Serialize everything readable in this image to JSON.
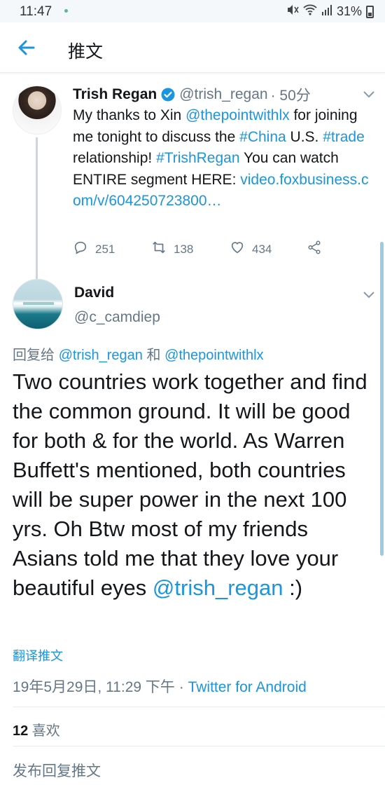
{
  "status_bar": {
    "time": "11:47",
    "battery": "31%",
    "icons": [
      "mute-icon",
      "wifi-icon",
      "signal-icon",
      "battery-icon"
    ]
  },
  "header": {
    "title": "推文",
    "back_icon": "arrow-left-icon"
  },
  "parent_tweet": {
    "name": "Trish Regan",
    "handle": "@trish_regan",
    "time": "· 50分",
    "text_1": "My thanks to Xin ",
    "mention": "@thepointwithlx",
    "text_2": " for joining me tonight to discuss the ",
    "hashtag_china": "#China",
    "text_3": " U.S. ",
    "hashtag_trade": "#trade",
    "text_4": " relationship! ",
    "hashtag_trishregan": "#TrishRegan",
    "text_5": " You can watch ENTIRE segment HERE: ",
    "link": "video.foxbusiness.com/v/604250723800…",
    "replies": "251",
    "retweets": "138",
    "likes": "434"
  },
  "reply_tweet": {
    "name": "David",
    "handle": "@c_camdiep",
    "replying_label": "回复给 ",
    "replying_to_1": "@trish_regan",
    "replying_and": " 和 ",
    "replying_to_2": "@thepointwithlx",
    "text": "Two countries work together and find the common ground.  It will be good for both & for the world. As Warren Buffett's mentioned, both countries will be super power in the next 100 yrs.  Oh Btw most of my friends Asians told me that they love your beautiful eyes ",
    "mention": "@trish_regan",
    "text_end": " :)",
    "translate": "翻译推文",
    "timestamp": "19年5月29日, 11:29 下午 · ",
    "source": "Twitter for Android",
    "likes_count": "12",
    "likes_label": " 喜欢",
    "reply_placeholder": "发布回复推文"
  },
  "colors": {
    "accent": "#1b95e0",
    "secondary_text": "#657786",
    "primary_text": "#14171a"
  }
}
